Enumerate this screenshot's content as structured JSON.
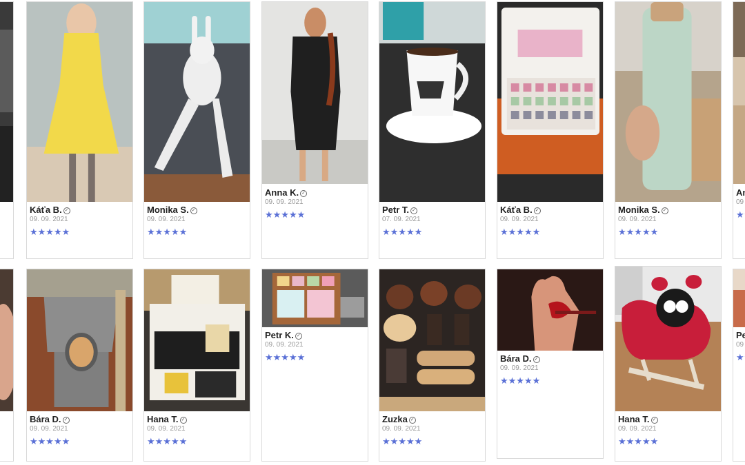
{
  "colors": {
    "star": "#5a70d6",
    "border": "#d9d9d9"
  },
  "verified_icon": "check-circle-icon",
  "stars_glyph": "★★★★★",
  "row1": [
    {
      "name": "",
      "date": "",
      "stars": 5,
      "photo": "partial-dark"
    },
    {
      "name": "Káťa B.",
      "date": "09. 09. 2021",
      "stars": 5,
      "photo": "yellow-dress"
    },
    {
      "name": "Monika S.",
      "date": "09. 09. 2021",
      "stars": 5,
      "photo": "plush-bunny"
    },
    {
      "name": "Anna K.",
      "date": "09. 09. 2021",
      "stars": 5,
      "photo": "black-dress"
    },
    {
      "name": "Petr T.",
      "date": "07. 09. 2021",
      "stars": 5,
      "photo": "coffee-cup"
    },
    {
      "name": "Káťa B.",
      "date": "09. 09. 2021",
      "stars": 5,
      "photo": "tea-box"
    },
    {
      "name": "Monika S.",
      "date": "09. 09. 2021",
      "stars": 5,
      "photo": "water-bottle"
    },
    {
      "name": "An",
      "date": "09",
      "stars": 5,
      "photo": "partial-room"
    }
  ],
  "row2": [
    {
      "name": "",
      "date": "",
      "stars": 5,
      "photo": "partial-hand"
    },
    {
      "name": "Bára D.",
      "date": "09. 09. 2021",
      "stars": 5,
      "photo": "cat-tree"
    },
    {
      "name": "Hana T.",
      "date": "09. 09. 2021",
      "stars": 5,
      "photo": "gift-box"
    },
    {
      "name": "Petr K.",
      "date": "09. 09. 2021",
      "stars": 5,
      "photo": "gift-set"
    },
    {
      "name": "Zuzka",
      "date": "09. 09. 2021",
      "stars": 5,
      "photo": "sweets-box"
    },
    {
      "name": "Bára D.",
      "date": "09. 09. 2021",
      "stars": 5,
      "photo": "hand-toy"
    },
    {
      "name": "Hana T.",
      "date": "09. 09. 2021",
      "stars": 5,
      "photo": "ladybug-rocker"
    },
    {
      "name": "Pe",
      "date": "09",
      "stars": 5,
      "photo": "partial-room2"
    }
  ]
}
